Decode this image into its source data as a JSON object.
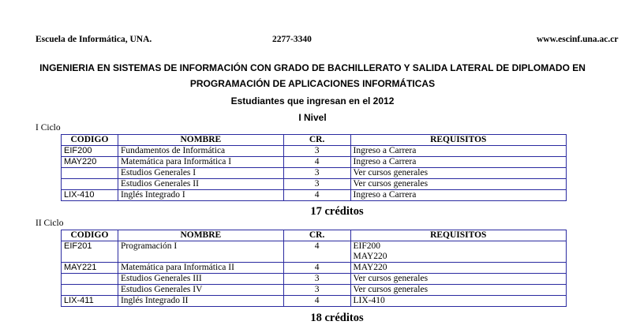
{
  "header": {
    "school": "Escuela de Informática, UNA.",
    "phone": "2277-3340",
    "website": "www.escinf.una.ac.cr"
  },
  "titles": {
    "line1": "INGENIERIA EN SISTEMAS DE INFORMACIÓN CON GRADO DE BACHILLERATO Y SALIDA LATERAL DE DIPLOMADO EN",
    "line2": "PROGRAMACIÓN DE APLICACIONES INFORMÁTICAS",
    "line3": "Estudiantes que ingresan en el 2012",
    "level": "I Nivel"
  },
  "columns": {
    "code": "CODIGO",
    "name": "NOMBRE",
    "credits": "CR.",
    "requirements": "REQUISITOS"
  },
  "cycles": [
    {
      "label": "I Ciclo",
      "total": "17 créditos",
      "rows": [
        {
          "code": "EIF200",
          "name": "Fundamentos de Informática",
          "cr": "3",
          "req": [
            "Ingreso a Carrera"
          ]
        },
        {
          "code": "MAY220",
          "name": "Matemática para Informática I",
          "cr": "4",
          "req": [
            "Ingreso a Carrera"
          ]
        },
        {
          "code": "",
          "name": "Estudios Generales I",
          "cr": "3",
          "req": [
            "Ver cursos generales"
          ]
        },
        {
          "code": "",
          "name": "Estudios Generales II",
          "cr": "3",
          "req": [
            "Ver cursos generales"
          ]
        },
        {
          "code": "LIX-410",
          "name": "Inglés Integrado I",
          "cr": "4",
          "req": [
            "Ingreso a Carrera"
          ]
        }
      ]
    },
    {
      "label": "II Ciclo",
      "total": "18 créditos",
      "rows": [
        {
          "code": "EIF201",
          "name": "Programación I",
          "cr": "4",
          "req": [
            "EIF200",
            "MAY220"
          ]
        },
        {
          "code": "MAY221",
          "name": "Matemática para Informática II",
          "cr": "4",
          "req": [
            "MAY220"
          ]
        },
        {
          "code": "",
          "name": "Estudios Generales III",
          "cr": "3",
          "req": [
            "Ver cursos generales"
          ]
        },
        {
          "code": "",
          "name": "Estudios Generales IV",
          "cr": "3",
          "req": [
            "Ver cursos generales"
          ]
        },
        {
          "code": "LIX-411",
          "name": "Inglés Integrado II",
          "cr": "4",
          "req": [
            "LIX-410"
          ]
        }
      ]
    }
  ]
}
